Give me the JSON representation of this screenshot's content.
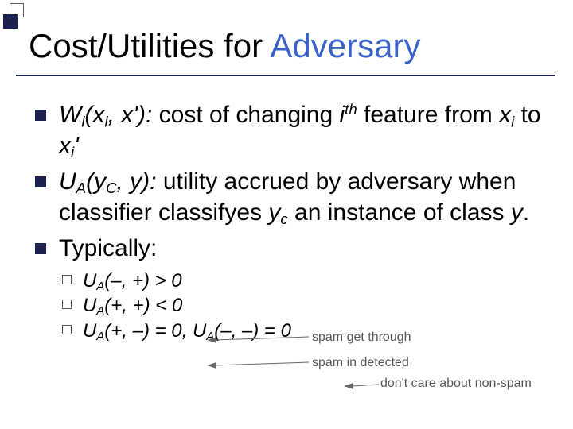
{
  "title": {
    "plain": "Cost/Utilities for ",
    "accent": "Adversary"
  },
  "bullets": {
    "w_pre": "W",
    "w_sub": "i",
    "w_args": "(x",
    "w_arg_sub": "i",
    "w_args2": ", x'):",
    "w_rest": " cost of changing ",
    "w_ith_i": "i",
    "w_ith_th": "th",
    "w_rest2": " feature from ",
    "w_from": "x",
    "w_from_sub": "i",
    "w_to_word": " to ",
    "w_to": "x",
    "w_to_sub": "i",
    "w_to_prime": "'",
    "u_pre": "U",
    "u_sub": "A",
    "u_args": "(y",
    "u_arg_sub": "C",
    "u_args2": ", y):",
    "u_rest": " utility accrued by adversary when classifier classifyes ",
    "u_yc": "y",
    "u_yc_sub": "c",
    "u_rest2": " an instance of class ",
    "u_y": "y",
    "u_end": ".",
    "typ": "Typically:"
  },
  "cases": {
    "c1_pre": "U",
    "c1_sub": "A",
    "c1_rest": "(–, +) > 0",
    "c2_pre": "U",
    "c2_sub": "A",
    "c2_rest": "(+, +) < 0",
    "c3_pre": "U",
    "c3_sub": "A",
    "c3_mid": "(+, –) = 0,  ",
    "c3_pre2": "U",
    "c3_sub2": "A",
    "c3_rest": "(–, –) = 0"
  },
  "notes": {
    "n1": "spam get through",
    "n2": "spam in detected",
    "n3": "don't care about non-spam"
  }
}
